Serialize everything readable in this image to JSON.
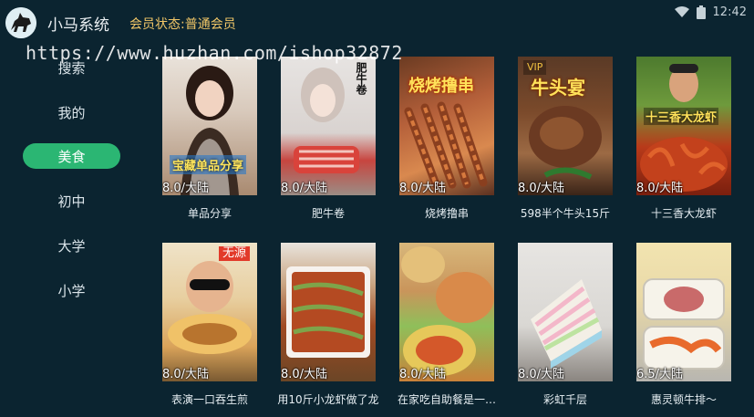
{
  "header": {
    "app_title": "小马系统",
    "member_status": "会员状态:普通会员",
    "clock": "12:42"
  },
  "watermark": "https://www.huzhan.com/ishop32872",
  "sidebar": {
    "items": [
      {
        "label": "搜索",
        "active": false
      },
      {
        "label": "我的",
        "active": false
      },
      {
        "label": "美食",
        "active": true
      },
      {
        "label": "初中",
        "active": false
      },
      {
        "label": "大学",
        "active": false
      },
      {
        "label": "小学",
        "active": false
      }
    ]
  },
  "cards": [
    {
      "title": "单品分享",
      "rating": "8.0/大陆",
      "overlay": "宝藏单品分享",
      "badge": ""
    },
    {
      "title": "肥牛卷",
      "rating": "8.0/大陆",
      "overlay": "肥牛卷",
      "badge": ""
    },
    {
      "title": "烧烤撸串",
      "rating": "8.0/大陆",
      "overlay": "烧烤撸串",
      "badge": ""
    },
    {
      "title": "598半个牛头15斤",
      "rating": "8.0/大陆",
      "overlay": "牛头宴",
      "badge": "VIP"
    },
    {
      "title": "十三香大龙虾",
      "rating": "8.0/大陆",
      "overlay": "十三香大龙虾",
      "badge": ""
    },
    {
      "title": "表演一口吞生煎",
      "rating": "8.0/大陆",
      "overlay": "",
      "badge": "无源"
    },
    {
      "title": "用10斤小龙虾做了龙",
      "rating": "8.0/大陆",
      "overlay": "",
      "badge": ""
    },
    {
      "title": "在家吃自助餐是一…",
      "rating": "8.0/大陆",
      "overlay": "",
      "badge": ""
    },
    {
      "title": "彩虹千层",
      "rating": "8.0/大陆",
      "overlay": "",
      "badge": ""
    },
    {
      "title": "惠灵顿牛排～",
      "rating": "6.5/大陆",
      "overlay": "",
      "badge": ""
    }
  ],
  "colors": {
    "background": "#0b2430",
    "accent": "#2bb673",
    "member_status": "#f1c667"
  }
}
